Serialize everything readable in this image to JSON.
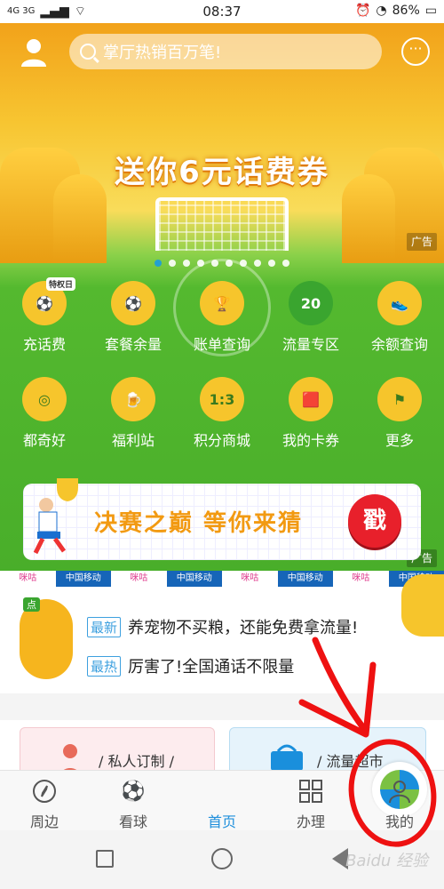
{
  "status": {
    "signal_left": "4G 3G",
    "time": "08:37",
    "battery": "86%"
  },
  "search": {
    "placeholder": "掌厅热销百万笔!"
  },
  "hero": {
    "promo_text": "送你6元话费券",
    "ad_label": "广告",
    "carousel_count": 10,
    "carousel_active": 0
  },
  "services": [
    {
      "label": "充话费",
      "icon": "football-icon",
      "badge": "特权日"
    },
    {
      "label": "套餐余量",
      "icon": "ball-scarf-icon"
    },
    {
      "label": "账单查询",
      "icon": "trophy-icon"
    },
    {
      "label": "流量专区",
      "icon": "jersey-icon",
      "icon_text": "20"
    },
    {
      "label": "余额查询",
      "icon": "boot-icon"
    },
    {
      "label": "都奇好",
      "icon": "stadium-icon"
    },
    {
      "label": "福利站",
      "icon": "beer-icon"
    },
    {
      "label": "积分商城",
      "icon": "scoreboard-icon",
      "icon_text": "1:3"
    },
    {
      "label": "我的卡券",
      "icon": "red-card-icon"
    },
    {
      "label": "更多",
      "icon": "flag-icon"
    }
  ],
  "banner": {
    "text": "决赛之巅 等你来猜",
    "button": "戳",
    "ad_label": "广告"
  },
  "sponsors": [
    "咪咕",
    "中国移动",
    "咪咕",
    "中国移动",
    "咪咕",
    "中国移动",
    "咪咕",
    "中国移动"
  ],
  "news": {
    "mascot_tag": "点",
    "items": [
      {
        "tag": "最新",
        "text": "养宠物不买粮，还能免费拿流量!"
      },
      {
        "tag": "最热",
        "text": "厉害了!全国通话不限量"
      }
    ]
  },
  "cards": [
    {
      "label": "/ 私人订制 /"
    },
    {
      "label": "/ 流量超市"
    }
  ],
  "nav": [
    {
      "label": "周边",
      "icon": "compass-icon"
    },
    {
      "label": "看球",
      "icon": "football-icon"
    },
    {
      "label": "首页",
      "icon": "china-mobile-logo-icon"
    },
    {
      "label": "办理",
      "icon": "grid-icon"
    },
    {
      "label": "我的",
      "icon": "person-icon"
    }
  ],
  "watermark": "Baidu 经验",
  "colors": {
    "accent": "#1f8fdc",
    "green": "#49ae2a",
    "yellow": "#f6c52c",
    "red": "#e8202b"
  }
}
